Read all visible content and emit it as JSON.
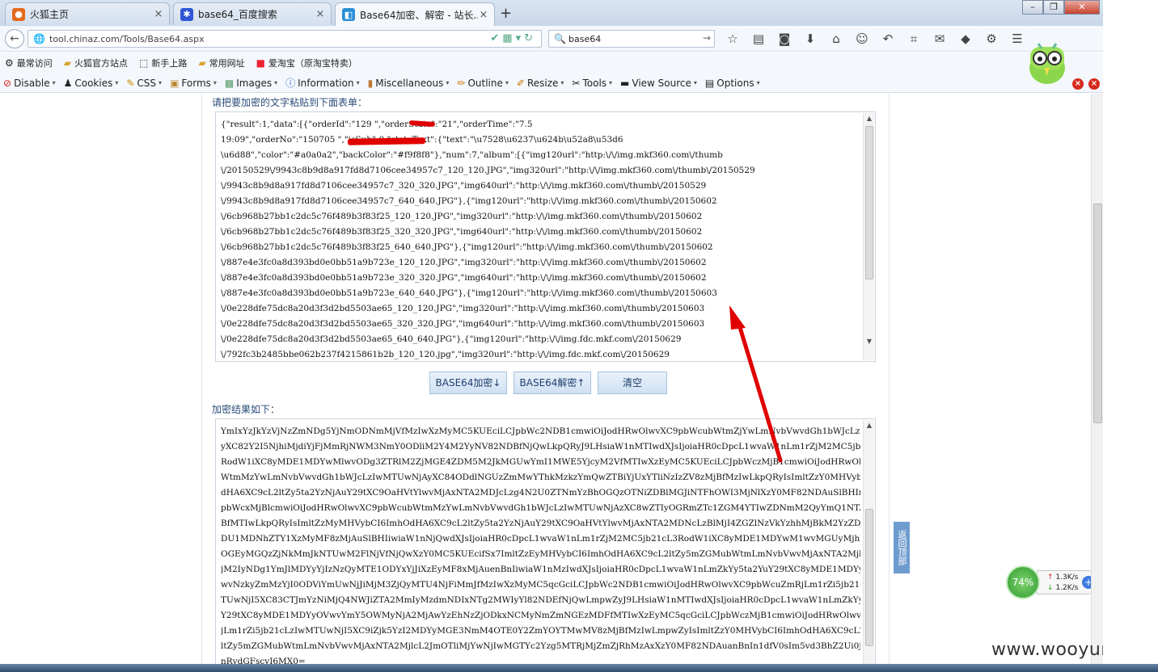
{
  "browser": {
    "tabs": [
      {
        "label": "火狐主页",
        "icon": "firefox-icon"
      },
      {
        "label": "base64_百度搜索",
        "icon": "baidu-icon"
      },
      {
        "label": "Base64加密、解密 - 站长...",
        "icon": "chinaz-icon"
      }
    ],
    "url": "tool.chinaz.com/Tools/Base64.aspx",
    "search_value": "base64",
    "bookmarks": [
      "最常访问",
      "火狐官方站点",
      "新手上路",
      "常用网址",
      "爱淘宝（原淘宝特卖）"
    ],
    "webdev_toolbar": [
      "Disable",
      "Cookies",
      "CSS",
      "Forms",
      "Images",
      "Information",
      "Miscellaneous",
      "Outline",
      "Resize",
      "Tools",
      "View Source",
      "Options"
    ]
  },
  "page": {
    "input_label": "请把要加密的文字粘贴到下面表单：",
    "input_lines": [
      "{\"result\":1,\"data\":[{\"orderId\":\"129    \",\"orderState\":\"21\",\"orderTime\":\"7.5",
      "19:09\",\"orderNo\":\"150705               \",\"isSub\":0,\"stateText\":{\"text\":\"\\u7528\\u6237\\u624b\\u52a8\\u53d6",
      "\\u6d88\",\"color\":\"#a0a0a2\",\"backColor\":\"#f9f8f8\"},\"num\":7,\"album\":[{\"img120url\":\"http:\\/\\/img.mkf360.com\\/thumb",
      "\\/20150529\\/9943c8b9d8a917fd8d7106cee34957c7_120_120.JPG\",\"img320url\":\"http:\\/\\/img.mkf360.com\\/thumb\\/20150529",
      "\\/9943c8b9d8a917fd8d7106cee34957c7_320_320.JPG\",\"img640url\":\"http:\\/\\/img.mkf360.com\\/thumb\\/20150529",
      "\\/9943c8b9d8a917fd8d7106cee34957c7_640_640.JPG\"},{\"img120url\":\"http:\\/\\/img.mkf360.com\\/thumb\\/20150602",
      "\\/6cb968b27bb1c2dc5c76f489b3f83f25_120_120.JPG\",\"img320url\":\"http:\\/\\/img.mkf360.com\\/thumb\\/20150602",
      "\\/6cb968b27bb1c2dc5c76f489b3f83f25_320_320.JPG\",\"img640url\":\"http:\\/\\/img.mkf360.com\\/thumb\\/20150602",
      "\\/6cb968b27bb1c2dc5c76f489b3f83f25_640_640.JPG\"},{\"img120url\":\"http:\\/\\/img.mkf360.com\\/thumb\\/20150602",
      "\\/887e4e3fc0a8d393bd0e0bb51a9b723e_120_120.JPG\",\"img320url\":\"http:\\/\\/img.mkf360.com\\/thumb\\/20150602",
      "\\/887e4e3fc0a8d393bd0e0bb51a9b723e_320_320.JPG\",\"img640url\":\"http:\\/\\/img.mkf360.com\\/thumb\\/20150602",
      "\\/887e4e3fc0a8d393bd0e0bb51a9b723e_640_640.JPG\"},{\"img120url\":\"http:\\/\\/img.mkf360.com\\/thumb\\/20150603",
      "\\/0e228dfe75dc8a20d3f3d2bd5503ae65_120_120.JPG\",\"img320url\":\"http:\\/\\/img.mkf360.com\\/thumb\\/20150603",
      "\\/0e228dfe75dc8a20d3f3d2bd5503ae65_320_320.JPG\",\"img640url\":\"http:\\/\\/img.mkf360.com\\/thumb\\/20150603",
      "\\/0e228dfe75dc8a20d3f3d2bd5503ae65_640_640.JPG\"},{\"img120url\":\"http:\\/\\/img.fdc.mkf.com\\/20150629",
      "\\/792fc3b2485bbe062b237f4215861b2b_120_120.jpg\",\"img320url\":\"http:\\/\\/img.fdc.mkf.com\\/20150629"
    ],
    "buttons": [
      "BASE64加密↓",
      "BASE64解密↑",
      "清空"
    ],
    "output_label": "加密结果如下：",
    "output_lines": [
      "YmIxYzJkYzVjNzZmNDg5YjNmODNmMjVfMzIwXzMyMC5KUEciLCJpbWc2NDB1cmwiOiJodHRwOlwvXC9pbWcubWtmZjYwLmNvbVwvdGh1bWJcLzIwMTUwNjA",
      "yXC82Y2I5NjhiMjdiYjFjMmRjNWM3NmY0ODliM2Y4M2YyNV82NDBfNjQwLkpQRyJ9LHsiaW1nMTIwdXJsIjoiaHR0cDpcL1wvaW1nLm1rZjM2MC5jb21cL3",
      "RodW1iXC8yMDE1MDYwMlwvODg3ZTRlM2ZjMGE4ZDM5M2JkMGUwYmI1MWE5YjcyM2VfMTIwXzEyMC5KUEciLCJpbWczMjB1cmwiOiJodHRwOlwvXC9pbWcub",
      "WtmMzYwLmNvbVwvdGh1bWJcLzIwMTUwNjAyXC84ODdlNGUzZmMwYThkMzkzYmQwZTBiYjUxYTliNzIzZV8zMjBfMzIwLkpQRyIsImltZzY0MHVybCI6ImhO",
      "dHA6XC9cL2ltZy5ta2YzNjAuY29tXC9OaHVtYlwvMjAxNTA2MDJcLzg4N2U0ZTNmYzBhOGQzOTNiZDBlMGJiNTFhOWI3MjNlXzY0MF82NDAuSlBHIn0seyJ",
      "pbWcxMjBlcmwiOiJodHRwOlwvXC9pbWcubWtmMzYwLmNvbVwvdGh1bWJcLzIwMTUwNjAzXC8wZTIyOGRmZTc1ZGM4YTIwZDNmM2QyYmQ1NTAzYWU2NV8xMjB",
      "BfMTIwLkpQRyIsImltZzMyMHVybCI6ImhOdHA6XC9cL2ltZy5ta2YzNjAuY29tXC9OaHVtYlwvMjAxNTA2MDNcLzBlMjI4ZGZlNzVkYzhhMjBkM2YzZDJiZ",
      "DU1MDNhZTY1XzMyMF8zMjAuSlBHIiwiaW1nNjQwdXJsIjoiaHR0cDpcL1wvaW1nLm1rZjM2MC5jb21cL3RodW1iXC8yMDE1MDYwM1wvMGUyMjhkZmU3NWRj",
      "OGEyMGQzZjNkMmJkNTUwM2FlNjVfNjQwXzY0MC5KUEcifSx7ImltZzEyMHVybCI6ImhOdHA6XC9cL2ltZy5mZGMubWtmLmNvbVwvMjAxNTA2MjlcLzc5MmZ",
      "jM2IyNDg1YmJlMDYyYjIzNzQyMTE1ODYxYjJiXzEyMF8xMjAuenBnIiwiaW1nMzIwdXJsIjoiaHR0cDpcL1wvaW1nLmZkYy5ta2YuY29tXC8yMDE1MDYyOV",
      "wvNzkyZmMzYjI0ODViYmUwNjJiMjM3ZjQyMTU4NjFiMmJfMzIwXzMyMC5qcGciLCJpbWc2NDB1cmwiOiJodHRwOlwvXC9pbWcuZmRjLm1rZi5jb21cLzIwM",
      "TUwNjI5XC83CTJmYzNiMjQ4NWJiZTA2MmIyMzdmNDIxNTg2MWIyYl82NDEfNjQwLmpwZyJ9LHsiaW1nMTIwdXJsIjoiaHR0cDpcL1wvaW1nLmZkYy5ta2Yu",
      "Y29tXC8yMDE1MDYyOVwvYmY5OWMyNjA2MjAwYzEhNzZjODkxNCMyNmZmNGEzMDFfMTIwXzEyMC5qcGciLCJpbWczMjB1cmwiOiJodHRwOlwvXC9pbWcuZmR",
      "jLm1rZi5jb21cLzIwMTUwNjI5XC9iZjk5YzI2MDYyMGE3NmM4OTE0Y2ZmYOYTMwMV8zMjBfMzIwLmpwZyIsImltZzY0MHVybCI6ImhOdHA6XC9cL2",
      "ltZy5mZGMubWtmLmNvbVwvMjAxNTA2MjlcL2JmOTliMjYwNjIwMGTYc2Yzg5MTRjMjZmZjRhMzAxXzY0MF82NDAuanBnIn1dfV0sIm5vd3BhZ2Ui0jEsI",
      "nRvdGFscyI6MX0="
    ]
  },
  "widgets": {
    "back_to_top": "返回顶部",
    "speed_percent": "74%",
    "upload_speed": "1.3K/s",
    "download_speed": "1.2K/s",
    "watermark": "www.wooyun.org"
  }
}
